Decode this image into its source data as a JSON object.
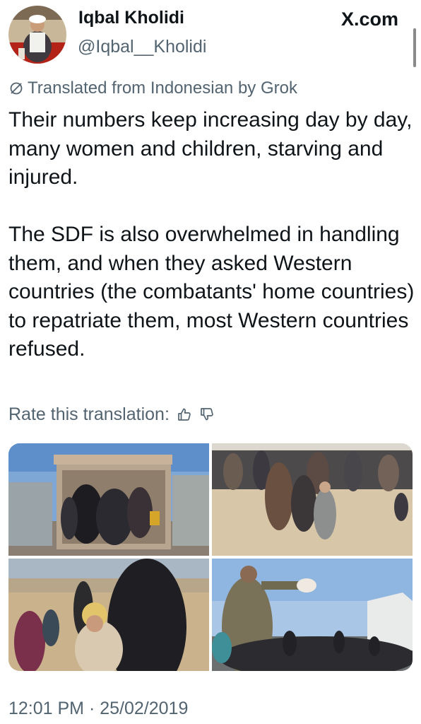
{
  "author": {
    "display_name": "Iqbal Kholidi",
    "handle": "@Iqbal__Kholidi",
    "avatar_icon": "avatar-photo"
  },
  "watermark": "X.com",
  "translation": {
    "notice": "Translated from Indonesian by Grok",
    "icon": "translate-icon",
    "rate_label": "Rate this translation:",
    "thumbs_up_icon": "thumbs-up-icon",
    "thumbs_down_icon": "thumbs-down-icon"
  },
  "tweet": {
    "paragraphs": [
      "Their numbers keep increasing day by day, many women and children, starving and injured.",
      "The SDF is also overwhelmed in handling them, and when they asked Western countries (the combatants' home countries) to repatriate them, most Western countries refused."
    ],
    "timestamp": "12:01 PM · 25/02/2019"
  },
  "media": {
    "photos": [
      {
        "subject": "truck-with-women-photo"
      },
      {
        "subject": "crowd-in-desert-photo"
      },
      {
        "subject": "mother-and-child-photo"
      },
      {
        "subject": "food-distribution-photo"
      }
    ]
  },
  "colors": {
    "text_primary": "#0f1419",
    "text_secondary": "#536471",
    "background": "#ffffff"
  }
}
